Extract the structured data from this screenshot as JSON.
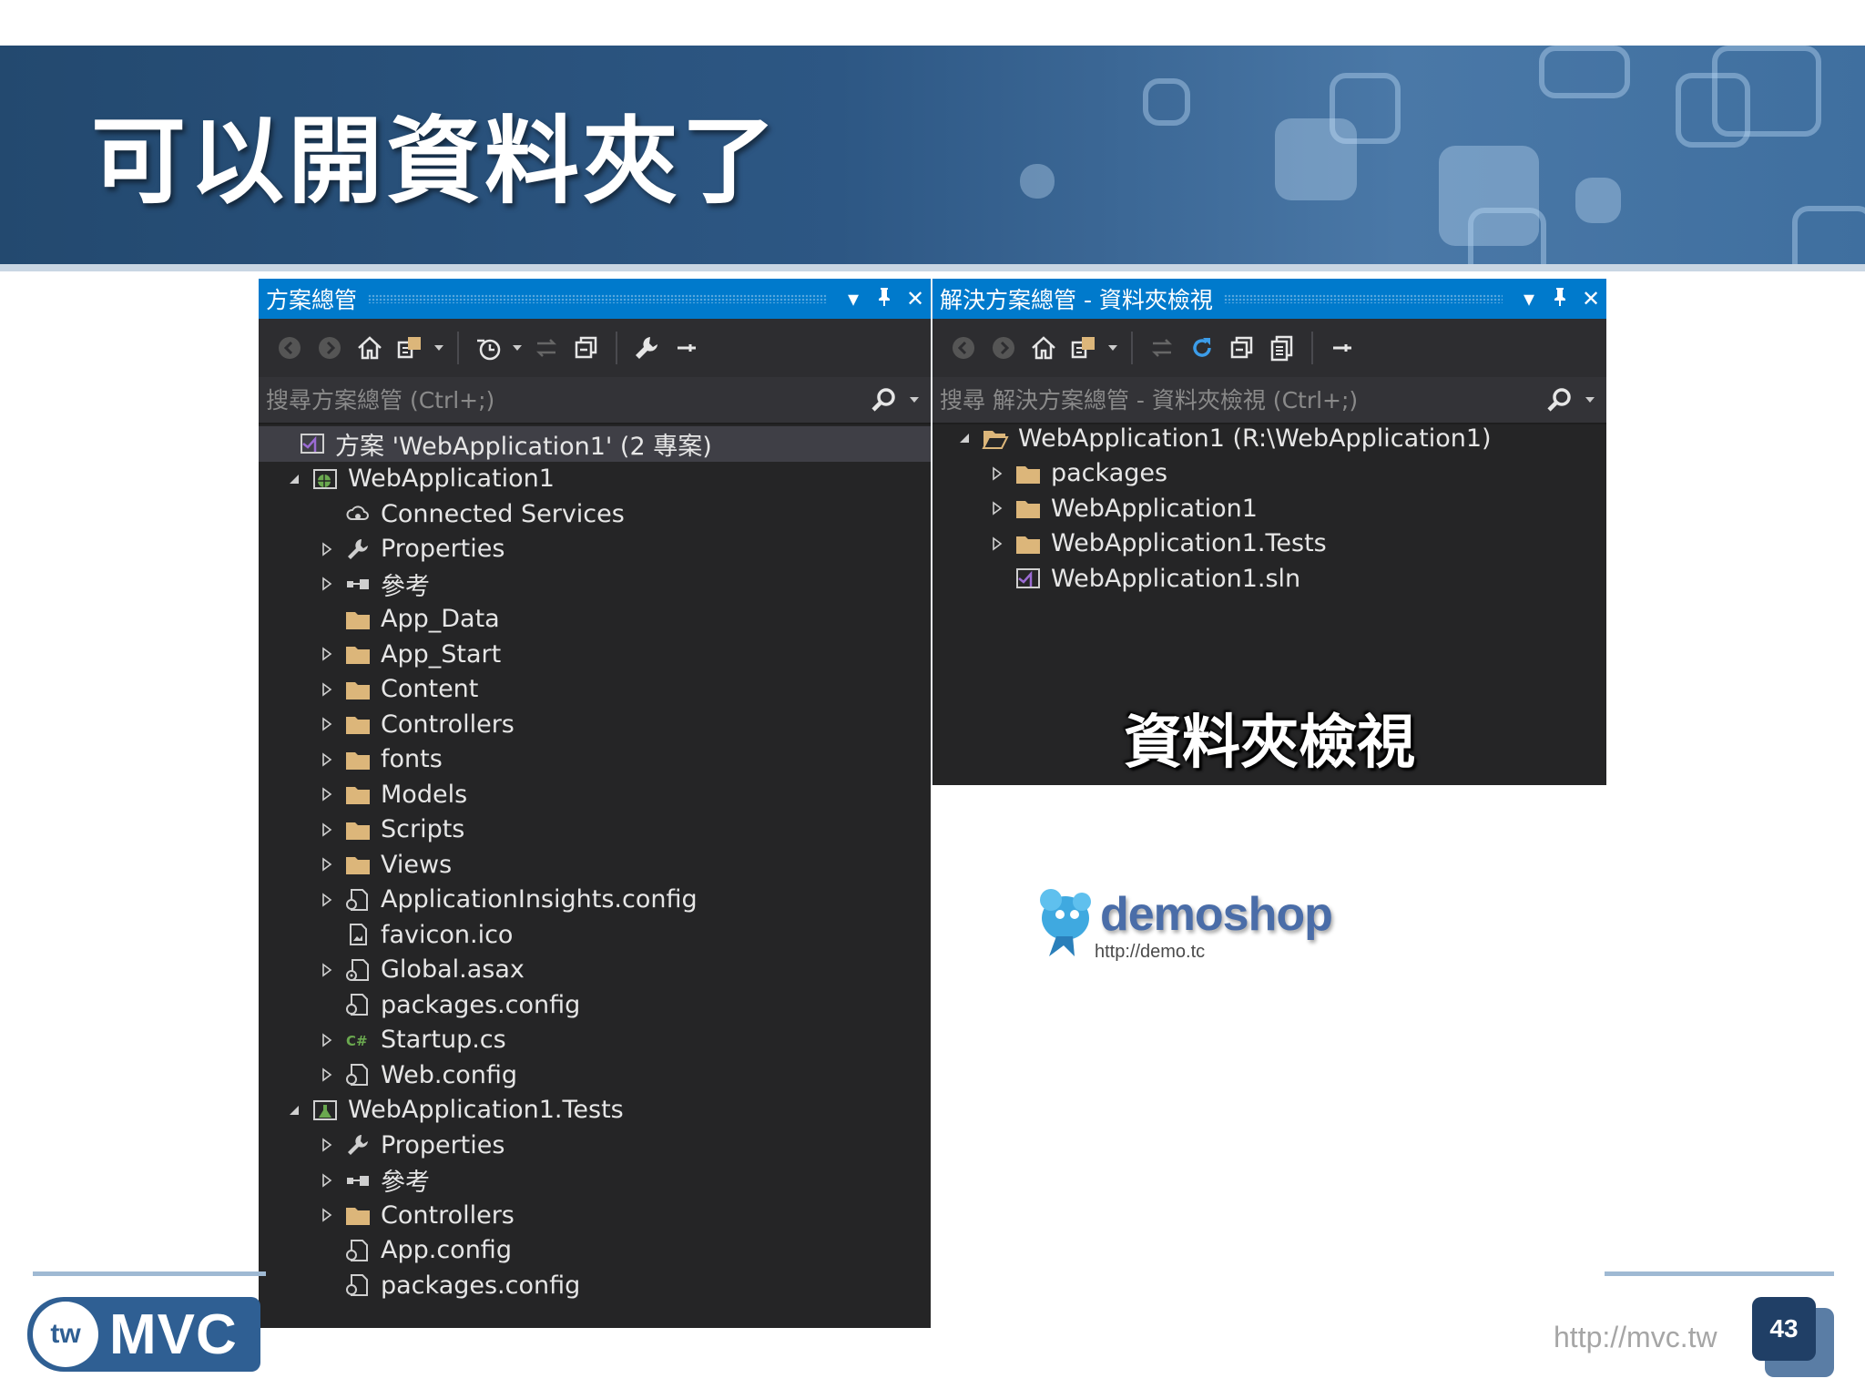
{
  "slide": {
    "title": "可以開資料夾了",
    "page_number": "43",
    "footer_url": "http://mvc.tw",
    "logo_tw": "tw",
    "logo_mvc": "MVC"
  },
  "colors": {
    "header_blue": "#2d5784",
    "vs_accent": "#007acc",
    "panel_bg": "#252526",
    "folder": "#dcb67a"
  },
  "solution_explorer": {
    "title": "方案總管",
    "search_placeholder": "搜尋方案總管 (Ctrl+;)",
    "tree": [
      {
        "label": "方案 'WebApplication1' (2 專案)",
        "icon": "solution-icon",
        "indent": 0,
        "arrow": "none",
        "selected": true
      },
      {
        "label": "WebApplication1",
        "icon": "web-project-icon",
        "indent": 0,
        "arrow": "expanded"
      },
      {
        "label": "Connected Services",
        "icon": "cloud-icon",
        "indent": 1,
        "arrow": "none"
      },
      {
        "label": "Properties",
        "icon": "wrench-icon",
        "indent": 1,
        "arrow": "collapsed"
      },
      {
        "label": "參考",
        "icon": "references-icon",
        "indent": 1,
        "arrow": "collapsed"
      },
      {
        "label": "App_Data",
        "icon": "folder-icon",
        "indent": 1,
        "arrow": "none"
      },
      {
        "label": "App_Start",
        "icon": "folder-icon",
        "indent": 1,
        "arrow": "collapsed"
      },
      {
        "label": "Content",
        "icon": "folder-icon",
        "indent": 1,
        "arrow": "collapsed"
      },
      {
        "label": "Controllers",
        "icon": "folder-icon",
        "indent": 1,
        "arrow": "collapsed"
      },
      {
        "label": "fonts",
        "icon": "folder-icon",
        "indent": 1,
        "arrow": "collapsed"
      },
      {
        "label": "Models",
        "icon": "folder-icon",
        "indent": 1,
        "arrow": "collapsed"
      },
      {
        "label": "Scripts",
        "icon": "folder-icon",
        "indent": 1,
        "arrow": "collapsed"
      },
      {
        "label": "Views",
        "icon": "folder-icon",
        "indent": 1,
        "arrow": "collapsed"
      },
      {
        "label": "ApplicationInsights.config",
        "icon": "config-file-icon",
        "indent": 1,
        "arrow": "collapsed"
      },
      {
        "label": "favicon.ico",
        "icon": "image-file-icon",
        "indent": 1,
        "arrow": "none"
      },
      {
        "label": "Global.asax",
        "icon": "asax-file-icon",
        "indent": 1,
        "arrow": "collapsed"
      },
      {
        "label": "packages.config",
        "icon": "config-file-icon",
        "indent": 1,
        "arrow": "none"
      },
      {
        "label": "Startup.cs",
        "icon": "csharp-file-icon",
        "indent": 1,
        "arrow": "collapsed"
      },
      {
        "label": "Web.config",
        "icon": "config-file-icon",
        "indent": 1,
        "arrow": "collapsed"
      },
      {
        "label": "WebApplication1.Tests",
        "icon": "test-project-icon",
        "indent": 0,
        "arrow": "expanded"
      },
      {
        "label": "Properties",
        "icon": "wrench-icon",
        "indent": 1,
        "arrow": "collapsed"
      },
      {
        "label": "參考",
        "icon": "references-icon",
        "indent": 1,
        "arrow": "collapsed"
      },
      {
        "label": "Controllers",
        "icon": "folder-icon",
        "indent": 1,
        "arrow": "collapsed"
      },
      {
        "label": "App.config",
        "icon": "config-file-icon",
        "indent": 1,
        "arrow": "none"
      },
      {
        "label": "packages.config",
        "icon": "config-file-icon",
        "indent": 1,
        "arrow": "none"
      }
    ]
  },
  "folder_view": {
    "title": "解決方案總管 - 資料夾檢視",
    "search_placeholder": "搜尋 解決方案總管 - 資料夾檢視 (Ctrl+;)",
    "caption": "資料夾檢視",
    "tree": [
      {
        "label": "WebApplication1 (R:\\WebApplication1)",
        "icon": "open-folder-icon",
        "indent": 0,
        "arrow": "expanded"
      },
      {
        "label": "packages",
        "icon": "folder-icon",
        "indent": 1,
        "arrow": "collapsed"
      },
      {
        "label": "WebApplication1",
        "icon": "folder-icon",
        "indent": 1,
        "arrow": "collapsed"
      },
      {
        "label": "WebApplication1.Tests",
        "icon": "folder-icon",
        "indent": 1,
        "arrow": "collapsed"
      },
      {
        "label": "WebApplication1.sln",
        "icon": "solution-icon",
        "indent": 1,
        "arrow": "none"
      }
    ]
  },
  "demoshop": {
    "name": "demoshop",
    "url": "http://demo.tc"
  }
}
